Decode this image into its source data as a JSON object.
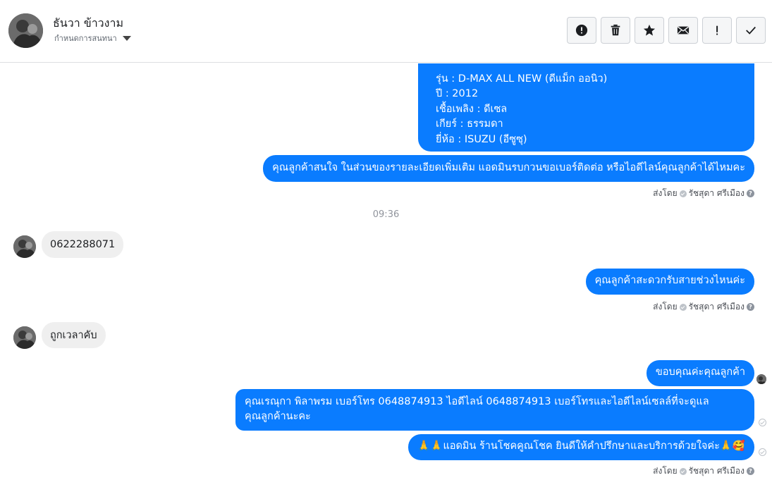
{
  "header": {
    "contact_name": "ธันวา ข้าวงาม",
    "subtitle": "กำหนดการสนทนา",
    "buttons": [
      {
        "name": "mark-spam-button",
        "icon": "alert-circle-icon"
      },
      {
        "name": "delete-button",
        "icon": "trash-icon"
      },
      {
        "name": "star-button",
        "icon": "star-icon"
      },
      {
        "name": "mark-unread-button",
        "icon": "envelope-icon"
      },
      {
        "name": "follow-up-button",
        "icon": "exclamation-icon"
      },
      {
        "name": "mark-done-button",
        "icon": "check-icon"
      }
    ]
  },
  "messages": {
    "m1": {
      "lines": [
        "รุ่น : D-MAX ALL NEW (ดีแม็ก ออนิว)",
        "ปี : 2012",
        "เชื้อเพลิง : ดีเซล",
        "เกียร์ : ธรรมดา",
        "ยี่ห้อ : ISUZU (อีซูซุ)"
      ]
    },
    "m2": "คุณลูกค้าสนใจ ในส่วนของรายละเอียดเพิ่มเติม แอดมินรบกวนขอเบอร์ติดต่อ หรือไอดีไลน์คุณลูกค้าได้ไหมคะ",
    "sent_by_label": "ส่งโดย",
    "sender_name": "รัชสุดา ศรีเมือง",
    "time_divider": "09:36",
    "m3": "0622288071",
    "m4": "คุณลูกค้าสะดวกรับสายช่วงไหนค่ะ",
    "m5": "ถูกเวลาคับ",
    "m6": "ขอบคุณค่ะคุณลูกค้า",
    "m7": {
      "lines": [
        "คุณเรณุกา พิลาพรม        เบอร์โทร 0648874913  ไอดีไลน์ 0648874913   เบอร์โทรและไอดีไลน์เซลล์ที่จะดูแล",
        "คุณลูกค้านะคะ"
      ]
    },
    "m8": "🙏🙏แอดมิน ร้านโชคคูณโชค ยินดีให้คำปรึกษาและบริการด้วยใจค่ะ🙏🥰"
  },
  "colors": {
    "outgoing_bubble": "#0a7cff",
    "incoming_bubble": "#efefef"
  }
}
